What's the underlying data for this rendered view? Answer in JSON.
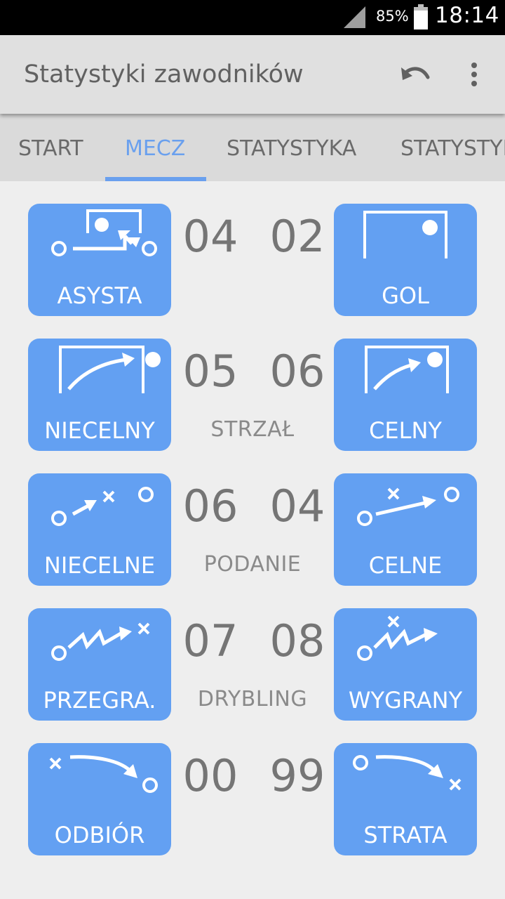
{
  "status_bar": {
    "battery_percent": "85%",
    "time": "18:14"
  },
  "app_bar": {
    "title": "Statystyki zawodników"
  },
  "tabs": [
    {
      "label": "START",
      "active": false
    },
    {
      "label": "MECZ",
      "active": true
    },
    {
      "label": "STATYSTYKA",
      "active": false
    },
    {
      "label": "STATYSTYKA",
      "active": false
    }
  ],
  "colors": {
    "accent": "#6aa0ee",
    "tile": "#63a0f2",
    "number": "#757575"
  },
  "rows": [
    {
      "left_label": "ASYSTA",
      "left_icon": "assist-icon",
      "left_value": "04",
      "right_value": "02",
      "category": "",
      "right_label": "GOL",
      "right_icon": "goal-icon"
    },
    {
      "left_label": "NIECELNY",
      "left_icon": "shot-off-target-icon",
      "left_value": "05",
      "right_value": "06",
      "category": "STRZAŁ",
      "right_label": "CELNY",
      "right_icon": "shot-on-target-icon"
    },
    {
      "left_label": "NIECELNE",
      "left_icon": "pass-intercepted-icon",
      "left_value": "06",
      "right_value": "04",
      "category": "PODANIE",
      "right_label": "CELNE",
      "right_icon": "pass-complete-icon"
    },
    {
      "left_label": "PRZEGRA.",
      "left_icon": "dribble-lost-icon",
      "left_value": "07",
      "right_value": "08",
      "category": "DRYBLING",
      "right_label": "WYGRANY",
      "right_icon": "dribble-won-icon"
    },
    {
      "left_label": "ODBIÓR",
      "left_icon": "tackle-icon",
      "left_value": "00",
      "right_value": "99",
      "category": "",
      "right_label": "STRATA",
      "right_icon": "ball-loss-icon"
    }
  ]
}
